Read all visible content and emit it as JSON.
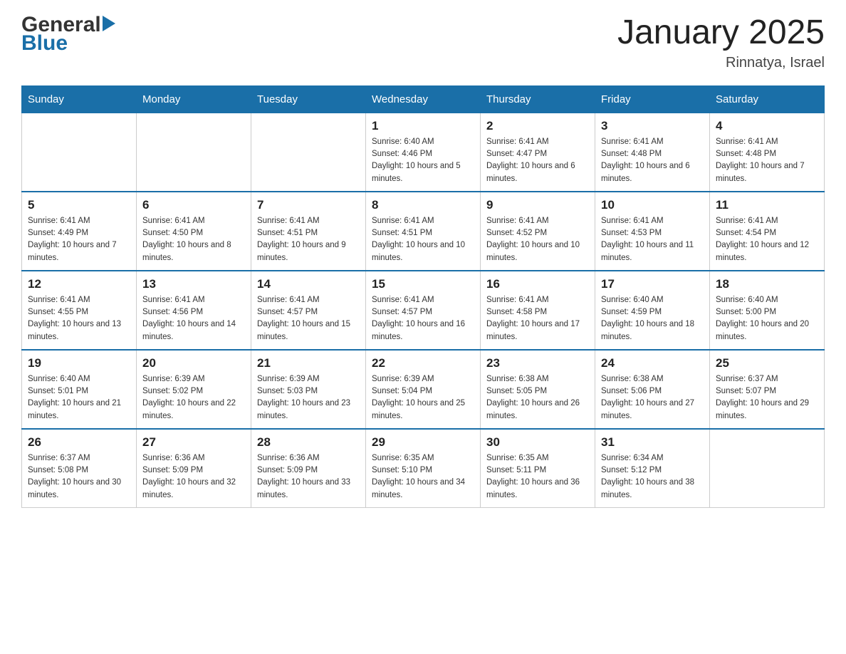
{
  "header": {
    "logo_general": "General",
    "logo_blue": "Blue",
    "title": "January 2025",
    "subtitle": "Rinnatya, Israel"
  },
  "calendar": {
    "weekdays": [
      "Sunday",
      "Monday",
      "Tuesday",
      "Wednesday",
      "Thursday",
      "Friday",
      "Saturday"
    ],
    "weeks": [
      [
        {
          "day": "",
          "info": ""
        },
        {
          "day": "",
          "info": ""
        },
        {
          "day": "",
          "info": ""
        },
        {
          "day": "1",
          "info": "Sunrise: 6:40 AM\nSunset: 4:46 PM\nDaylight: 10 hours and 5 minutes."
        },
        {
          "day": "2",
          "info": "Sunrise: 6:41 AM\nSunset: 4:47 PM\nDaylight: 10 hours and 6 minutes."
        },
        {
          "day": "3",
          "info": "Sunrise: 6:41 AM\nSunset: 4:48 PM\nDaylight: 10 hours and 6 minutes."
        },
        {
          "day": "4",
          "info": "Sunrise: 6:41 AM\nSunset: 4:48 PM\nDaylight: 10 hours and 7 minutes."
        }
      ],
      [
        {
          "day": "5",
          "info": "Sunrise: 6:41 AM\nSunset: 4:49 PM\nDaylight: 10 hours and 7 minutes."
        },
        {
          "day": "6",
          "info": "Sunrise: 6:41 AM\nSunset: 4:50 PM\nDaylight: 10 hours and 8 minutes."
        },
        {
          "day": "7",
          "info": "Sunrise: 6:41 AM\nSunset: 4:51 PM\nDaylight: 10 hours and 9 minutes."
        },
        {
          "day": "8",
          "info": "Sunrise: 6:41 AM\nSunset: 4:51 PM\nDaylight: 10 hours and 10 minutes."
        },
        {
          "day": "9",
          "info": "Sunrise: 6:41 AM\nSunset: 4:52 PM\nDaylight: 10 hours and 10 minutes."
        },
        {
          "day": "10",
          "info": "Sunrise: 6:41 AM\nSunset: 4:53 PM\nDaylight: 10 hours and 11 minutes."
        },
        {
          "day": "11",
          "info": "Sunrise: 6:41 AM\nSunset: 4:54 PM\nDaylight: 10 hours and 12 minutes."
        }
      ],
      [
        {
          "day": "12",
          "info": "Sunrise: 6:41 AM\nSunset: 4:55 PM\nDaylight: 10 hours and 13 minutes."
        },
        {
          "day": "13",
          "info": "Sunrise: 6:41 AM\nSunset: 4:56 PM\nDaylight: 10 hours and 14 minutes."
        },
        {
          "day": "14",
          "info": "Sunrise: 6:41 AM\nSunset: 4:57 PM\nDaylight: 10 hours and 15 minutes."
        },
        {
          "day": "15",
          "info": "Sunrise: 6:41 AM\nSunset: 4:57 PM\nDaylight: 10 hours and 16 minutes."
        },
        {
          "day": "16",
          "info": "Sunrise: 6:41 AM\nSunset: 4:58 PM\nDaylight: 10 hours and 17 minutes."
        },
        {
          "day": "17",
          "info": "Sunrise: 6:40 AM\nSunset: 4:59 PM\nDaylight: 10 hours and 18 minutes."
        },
        {
          "day": "18",
          "info": "Sunrise: 6:40 AM\nSunset: 5:00 PM\nDaylight: 10 hours and 20 minutes."
        }
      ],
      [
        {
          "day": "19",
          "info": "Sunrise: 6:40 AM\nSunset: 5:01 PM\nDaylight: 10 hours and 21 minutes."
        },
        {
          "day": "20",
          "info": "Sunrise: 6:39 AM\nSunset: 5:02 PM\nDaylight: 10 hours and 22 minutes."
        },
        {
          "day": "21",
          "info": "Sunrise: 6:39 AM\nSunset: 5:03 PM\nDaylight: 10 hours and 23 minutes."
        },
        {
          "day": "22",
          "info": "Sunrise: 6:39 AM\nSunset: 5:04 PM\nDaylight: 10 hours and 25 minutes."
        },
        {
          "day": "23",
          "info": "Sunrise: 6:38 AM\nSunset: 5:05 PM\nDaylight: 10 hours and 26 minutes."
        },
        {
          "day": "24",
          "info": "Sunrise: 6:38 AM\nSunset: 5:06 PM\nDaylight: 10 hours and 27 minutes."
        },
        {
          "day": "25",
          "info": "Sunrise: 6:37 AM\nSunset: 5:07 PM\nDaylight: 10 hours and 29 minutes."
        }
      ],
      [
        {
          "day": "26",
          "info": "Sunrise: 6:37 AM\nSunset: 5:08 PM\nDaylight: 10 hours and 30 minutes."
        },
        {
          "day": "27",
          "info": "Sunrise: 6:36 AM\nSunset: 5:09 PM\nDaylight: 10 hours and 32 minutes."
        },
        {
          "day": "28",
          "info": "Sunrise: 6:36 AM\nSunset: 5:09 PM\nDaylight: 10 hours and 33 minutes."
        },
        {
          "day": "29",
          "info": "Sunrise: 6:35 AM\nSunset: 5:10 PM\nDaylight: 10 hours and 34 minutes."
        },
        {
          "day": "30",
          "info": "Sunrise: 6:35 AM\nSunset: 5:11 PM\nDaylight: 10 hours and 36 minutes."
        },
        {
          "day": "31",
          "info": "Sunrise: 6:34 AM\nSunset: 5:12 PM\nDaylight: 10 hours and 38 minutes."
        },
        {
          "day": "",
          "info": ""
        }
      ]
    ]
  }
}
